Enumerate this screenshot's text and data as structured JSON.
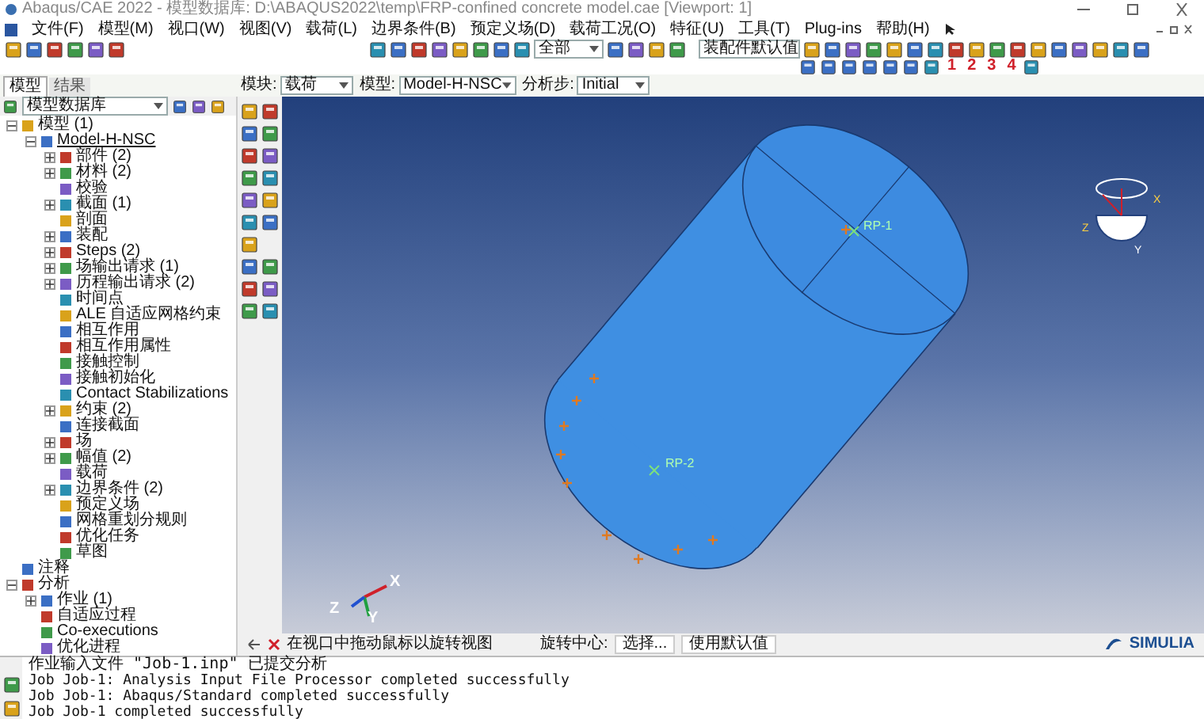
{
  "window": {
    "title": "Abaqus/CAE 2022 - 模型数据库: D:\\ABAQUS2022\\temp\\FRP-confined concrete model.cae [Viewport: 1]"
  },
  "menu": [
    "文件(F)",
    "模型(M)",
    "视口(W)",
    "视图(V)",
    "载荷(L)",
    "边界条件(B)",
    "预定义场(D)",
    "载荷工况(O)",
    "特征(U)",
    "工具(T)",
    "Plug-ins",
    "帮助(H)"
  ],
  "toolbar": {
    "filter": "全部",
    "display_group": "装配件默认值",
    "view_numbers": [
      "1",
      "2",
      "3",
      "4"
    ]
  },
  "tabs": [
    {
      "label": "模型",
      "selected": true
    },
    {
      "label": "结果",
      "selected": false
    }
  ],
  "module_bar": [
    {
      "label": "模块:",
      "value": "载荷"
    },
    {
      "label": "模型:",
      "value": "Model-H-NSC"
    },
    {
      "label": "分析步:",
      "value": "Initial"
    }
  ],
  "tree": {
    "selector": "模型数据库",
    "items": [
      {
        "label": "模型 (1)",
        "expanded": true,
        "children": [
          {
            "label": "Model-H-NSC",
            "expanded": true,
            "children": [
              {
                "label": "部件 (2)",
                "expanded": false
              },
              {
                "label": "材料 (2)",
                "expanded": false
              },
              {
                "label": "校验"
              },
              {
                "label": "截面 (1)",
                "expanded": false
              },
              {
                "label": "剖面"
              },
              {
                "label": "装配",
                "expanded": false
              },
              {
                "label": "Steps (2)",
                "expanded": false
              },
              {
                "label": "场输出请求 (1)",
                "expanded": false
              },
              {
                "label": "历程输出请求 (2)",
                "expanded": false
              },
              {
                "label": "时间点"
              },
              {
                "label": "ALE 自适应网格约束"
              },
              {
                "label": "相互作用"
              },
              {
                "label": "相互作用属性"
              },
              {
                "label": "接触控制"
              },
              {
                "label": "接触初始化"
              },
              {
                "label": "Contact Stabilizations"
              },
              {
                "label": "约束 (2)",
                "expanded": false
              },
              {
                "label": "连接截面"
              },
              {
                "label": "场",
                "expanded": false
              },
              {
                "label": "幅值 (2)",
                "expanded": false
              },
              {
                "label": "载荷"
              },
              {
                "label": "边界条件 (2)",
                "expanded": false
              },
              {
                "label": "预定义场"
              },
              {
                "label": "网格重划分规则"
              },
              {
                "label": "优化任务"
              },
              {
                "label": "草图"
              }
            ]
          }
        ]
      },
      {
        "label": "注释"
      },
      {
        "label": "分析",
        "expanded": true,
        "children": [
          {
            "label": "作业 (1)",
            "expanded": false
          },
          {
            "label": "自适应过程"
          },
          {
            "label": "Co-executions"
          },
          {
            "label": "优化进程"
          }
        ]
      }
    ]
  },
  "viewport": {
    "points": [
      "RP-1",
      "RP-2"
    ],
    "triad": [
      "X",
      "Y",
      "Z"
    ],
    "compass": [
      "X",
      "Y",
      "Z"
    ]
  },
  "prompt": {
    "text": "在视口中拖动鼠标以旋转视图",
    "label": "旋转中心:",
    "buttons": [
      "选择...",
      "使用默认值"
    ]
  },
  "brand": "SIMULIA",
  "messages": [
    "作业输入文件 \"Job-1.inp\" 已提交分析",
    "Job Job-1: Analysis Input File Processor completed successfully",
    "Job Job-1: Abaqus/Standard completed successfully",
    "Job Job-1 completed successfully"
  ]
}
